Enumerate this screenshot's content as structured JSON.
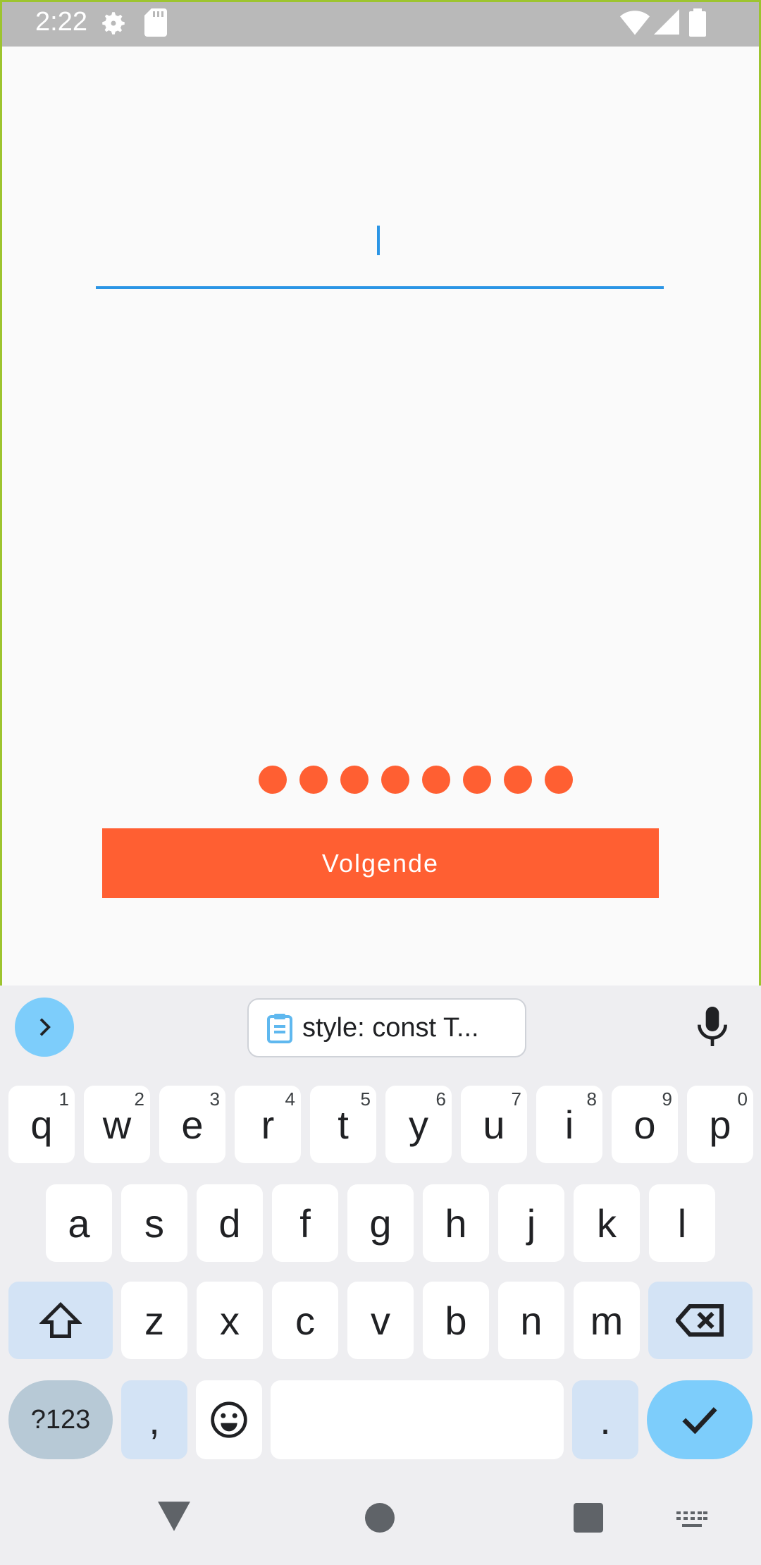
{
  "status_bar": {
    "time": "2:22",
    "icons": [
      "settings-icon",
      "sd-card-icon",
      "wifi-icon",
      "signal-icon",
      "battery-icon"
    ]
  },
  "form": {
    "input_value": "",
    "dots_count": 8,
    "next_button": "Volgende"
  },
  "colors": {
    "accent": "#ff5f32",
    "field_line": "#2b95e5",
    "frame": "#9dc42f"
  },
  "keyboard": {
    "clipboard_chip": "style: const T...",
    "rows": [
      [
        [
          "q",
          "1"
        ],
        [
          "w",
          "2"
        ],
        [
          "e",
          "3"
        ],
        [
          "r",
          "4"
        ],
        [
          "t",
          "5"
        ],
        [
          "y",
          "6"
        ],
        [
          "u",
          "7"
        ],
        [
          "i",
          "8"
        ],
        [
          "o",
          "9"
        ],
        [
          "p",
          "0"
        ]
      ],
      [
        [
          "a",
          ""
        ],
        [
          "s",
          ""
        ],
        [
          "d",
          ""
        ],
        [
          "f",
          ""
        ],
        [
          "g",
          ""
        ],
        [
          "h",
          ""
        ],
        [
          "j",
          ""
        ],
        [
          "k",
          ""
        ],
        [
          "l",
          ""
        ]
      ],
      [
        [
          "z",
          ""
        ],
        [
          "x",
          ""
        ],
        [
          "c",
          ""
        ],
        [
          "v",
          ""
        ],
        [
          "b",
          ""
        ],
        [
          "n",
          ""
        ],
        [
          "m",
          ""
        ]
      ]
    ],
    "symbols_key": "?123",
    "comma_key": ",",
    "period_key": "."
  }
}
